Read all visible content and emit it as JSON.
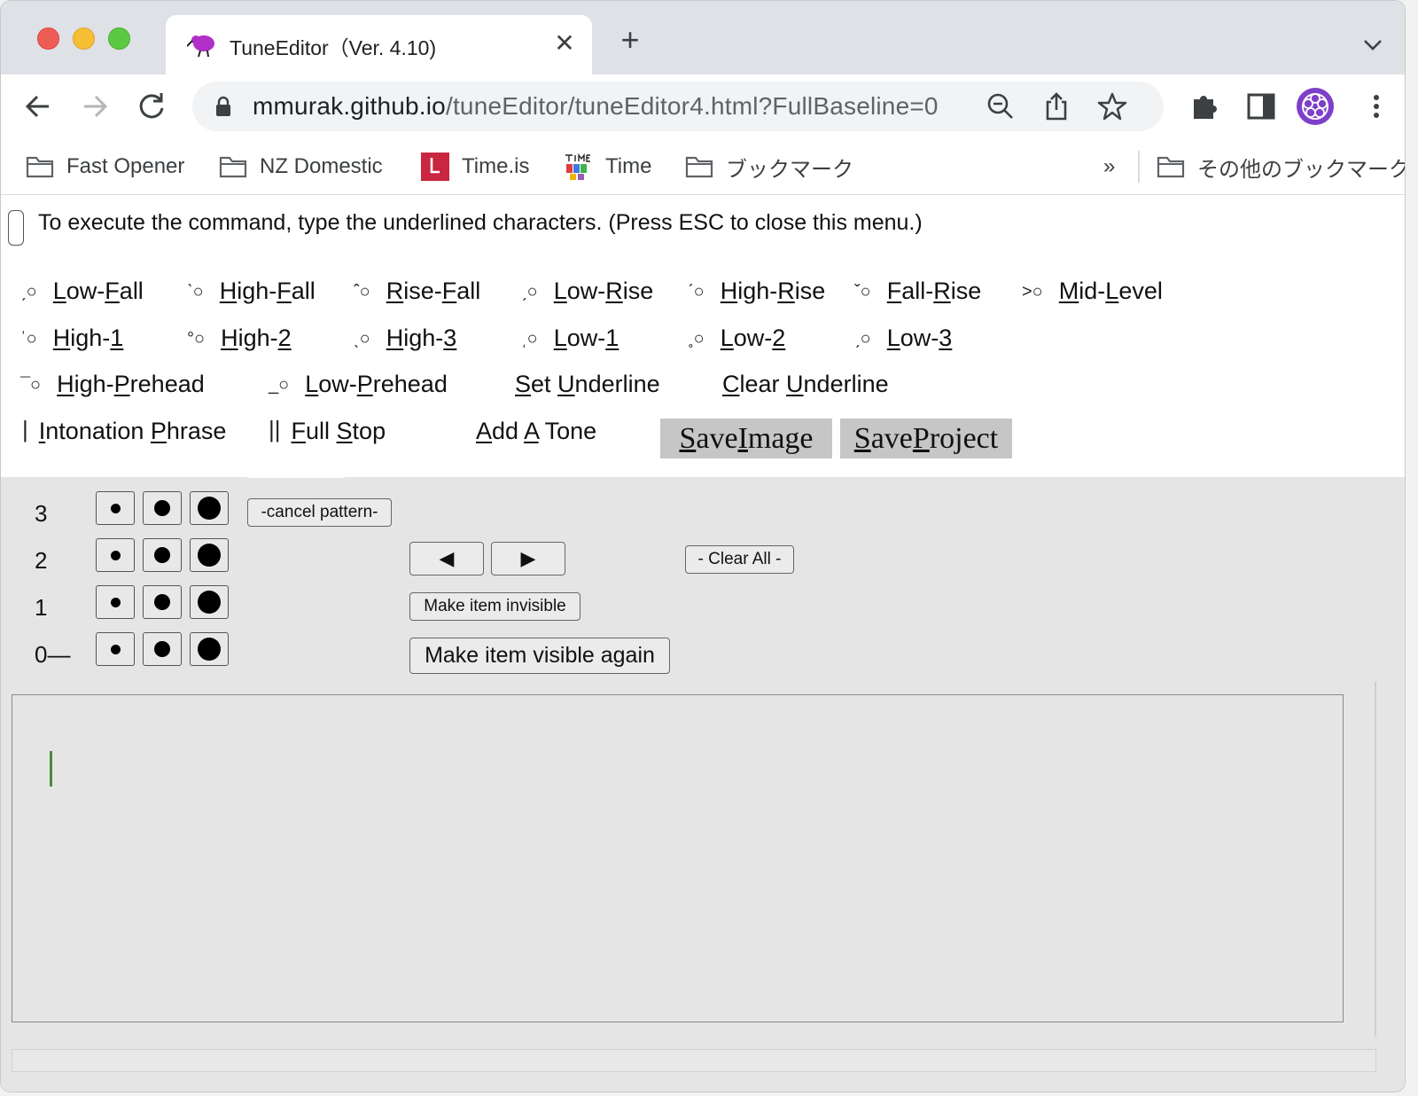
{
  "browser": {
    "tab_title": "TuneEditor（Ver. 4.10)",
    "url_host": "mmurak.github.io",
    "url_path": "/tuneEditor/tuneEditor4.html?FullBaseline=0",
    "new_tab": "+",
    "close_tab": "✕"
  },
  "bookmarks": {
    "items": [
      {
        "label": "Fast Opener",
        "icon": "folder-icon"
      },
      {
        "label": "NZ Domestic",
        "icon": "folder-icon"
      },
      {
        "label": "Time.is",
        "icon": "timeis-icon"
      },
      {
        "label": "Time",
        "icon": "time-icon"
      },
      {
        "label": "ブックマーク",
        "icon": "folder-icon"
      }
    ],
    "more": "»",
    "other": "その他のブックマーク"
  },
  "menu": {
    "hint": "To execute the command, type the underlined characters. (Press ESC to close this menu.)",
    "row1": [
      {
        "sym": "ˏ○",
        "key": "L",
        "pre": "",
        "rest1": "ow-",
        "key2": "F",
        "rest2": "all"
      },
      {
        "sym": "ˋ○",
        "key": "H",
        "pre": "",
        "rest1": "igh-",
        "key2": "F",
        "rest2": "all"
      },
      {
        "sym": "ˆ○",
        "key": "R",
        "pre": "",
        "rest1": "ise-",
        "key2": "F",
        "rest2": "all"
      },
      {
        "sym": "ˏ○",
        "key": "L",
        "pre": "",
        "rest1": "ow-",
        "key2": "R",
        "rest2": "ise"
      },
      {
        "sym": "ˊ○",
        "key": "H",
        "pre": "",
        "rest1": "igh-",
        "key2": "R",
        "rest2": "ise"
      },
      {
        "sym": "ˇ○",
        "key": "F",
        "pre": "",
        "rest1": "all-",
        "key2": "R",
        "rest2": "ise"
      },
      {
        "sym": "˃○",
        "key": "M",
        "pre": "",
        "rest1": "id-",
        "key2": "L",
        "rest2": "evel"
      }
    ],
    "row2": [
      {
        "sym": "ˈ○",
        "key": "H",
        "rest1": "igh-",
        "key2": "1",
        "rest2": ""
      },
      {
        "sym": "°○",
        "key": "H",
        "rest1": "igh-",
        "key2": "2",
        "rest2": ""
      },
      {
        "sym": "ˎ○",
        "key": "H",
        "rest1": "igh-",
        "key2": "3",
        "rest2": ""
      },
      {
        "sym": "ˌ○",
        "key": "L",
        "rest1": "ow-",
        "key2": "1",
        "rest2": ""
      },
      {
        "sym": "˳○",
        "key": "L",
        "rest1": "ow-",
        "key2": "2",
        "rest2": ""
      },
      {
        "sym": "ˏ○",
        "key": "L",
        "rest1": "ow-",
        "key2": "3",
        "rest2": ""
      }
    ],
    "row3": [
      {
        "sym": "¯○",
        "key": "H",
        "rest1": "igh-",
        "key2": "P",
        "rest2": "rehead"
      },
      {
        "sym": "_○",
        "key": "L",
        "rest1": "ow-",
        "key2": "P",
        "rest2": "rehead"
      }
    ],
    "set_underline": {
      "key": "S",
      "rest1": "et ",
      "key2": "U",
      "rest2": "nderline"
    },
    "clear_underline": {
      "key": "C",
      "rest1": "lear ",
      "key2": "U",
      "rest2": "nderline"
    },
    "intonation_phrase": {
      "sym": "|",
      "key": "I",
      "rest1": "ntonation ",
      "key2": "P",
      "rest2": "hrase"
    },
    "full_stop": {
      "sym": "||",
      "key": "F",
      "rest1": "ull ",
      "key2": "S",
      "rest2": "top"
    },
    "add_tone": {
      "key": "A",
      "rest1": "dd ",
      "key2": "A",
      "rest2": " Tone"
    },
    "save_image": {
      "key": "S",
      "rest1": "ave ",
      "key2": "I",
      "rest2": "mage"
    },
    "save_project": {
      "key": "S",
      "rest1": "ave ",
      "key2": "P",
      "rest2": "roject"
    }
  },
  "panel": {
    "levels": [
      "3",
      "2",
      "1",
      "0—"
    ],
    "cancel_pattern": "-cancel pattern-",
    "prev": "◀",
    "next": "▶",
    "clear_all": "- Clear All -",
    "make_invisible": "Make item invisible",
    "make_visible": "Make item visible again"
  }
}
